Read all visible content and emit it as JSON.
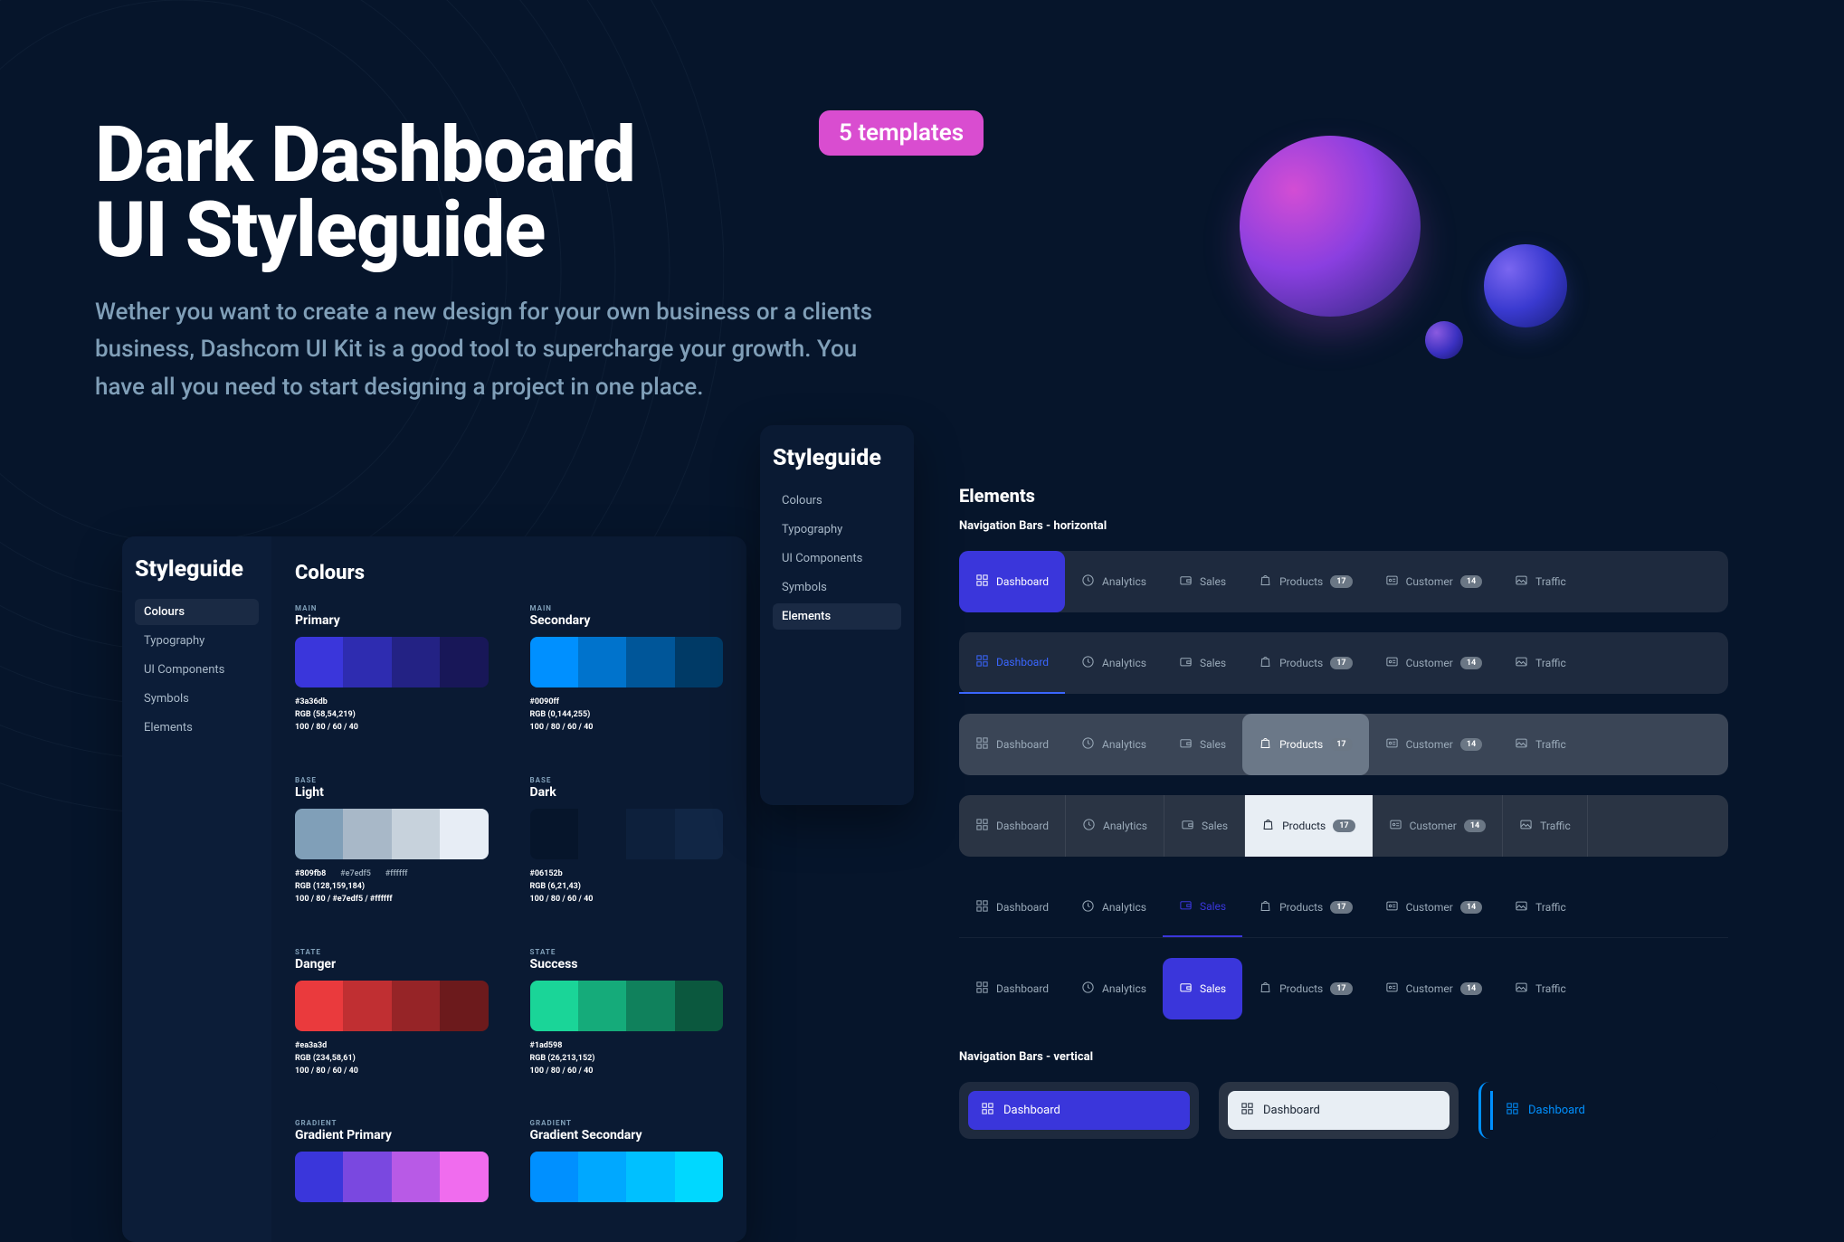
{
  "badge": "5 templates",
  "title_l1": "Dark Dashboard",
  "title_l2": "UI Styleguide",
  "subtitle": "Wether you want to create a new design for your own business or a clients business, Dashcom UI Kit is a good tool to supercharge your growth.  You have all you need to start designing a project in one place.",
  "sidebar": {
    "title": "Styleguide",
    "items": [
      "Colours",
      "Typography",
      "UI Components",
      "Symbols",
      "Elements"
    ]
  },
  "colours": {
    "heading": "Colours",
    "blocks": [
      {
        "kicker": "MAIN",
        "name": "Primary",
        "sw": [
          "#3a36db",
          "#2e2cb0",
          "#232284",
          "#181758"
        ],
        "hex": "#3a36db",
        "rgb": "RGB (58,54,219)",
        "scale": "100 / 80 / 60 / 40"
      },
      {
        "kicker": "MAIN",
        "name": "Secondary",
        "sw": [
          "#0090ff",
          "#0073cc",
          "#005699",
          "#003a66"
        ],
        "hex": "#0090ff",
        "rgb": "RGB (0,144,255)",
        "scale": "100 / 80 / 60 / 40"
      },
      {
        "kicker": "BASE",
        "name": "Light",
        "sw": [
          "#809fb8",
          "#a8b8c8",
          "#c7d2dc",
          "#e7edf5"
        ],
        "hex": "#809fb8",
        "rgb": "RGB (128,159,184)",
        "scale": "100 / 80 / #e7edf5 / #ffffff",
        "extra1": "#e7edf5",
        "extra2": "#ffffff"
      },
      {
        "kicker": "BASE",
        "name": "Dark",
        "sw": [
          "#06152b",
          "#0a1a33",
          "#0d203c",
          "#112645"
        ],
        "hex": "#06152b",
        "rgb": "RGB (6,21,43)",
        "scale": "100 / 80 / 60 / 40"
      },
      {
        "kicker": "STATE",
        "name": "Danger",
        "sw": [
          "#ea3a3d",
          "#c02f32",
          "#962427",
          "#6c1a1c"
        ],
        "hex": "#ea3a3d",
        "rgb": "RGB (234,58,61)",
        "scale": "100 / 80 / 60 / 40"
      },
      {
        "kicker": "STATE",
        "name": "Success",
        "sw": [
          "#1ad598",
          "#15ab7a",
          "#10815c",
          "#0b583e"
        ],
        "hex": "#1ad598",
        "rgb": "RGB (26,213,152)",
        "scale": "100 / 80 / 60 / 40"
      },
      {
        "kicker": "GRADIENT",
        "name": "Gradient Primary",
        "sw": [
          "#3a36db",
          "#7a48e0",
          "#b85ae6",
          "#f06cee"
        ],
        "hex": "",
        "rgb": "",
        "scale": ""
      },
      {
        "kicker": "GRADIENT",
        "name": "Gradient Secondary",
        "sw": [
          "#0090ff",
          "#00a8ff",
          "#00c0ff",
          "#00d8ff"
        ],
        "hex": "",
        "rgb": "",
        "scale": ""
      }
    ]
  },
  "elements": {
    "heading": "Elements",
    "horiz_title": "Navigation Bars - horizontal",
    "vert_title": "Navigation Bars - vertical",
    "navlabels": {
      "dashboard": "Dashboard",
      "analytics": "Analytics",
      "sales": "Sales",
      "products": "Products",
      "customer": "Customer",
      "traffic": "Traffic"
    },
    "badge_p": "17",
    "badge_c": "14"
  }
}
